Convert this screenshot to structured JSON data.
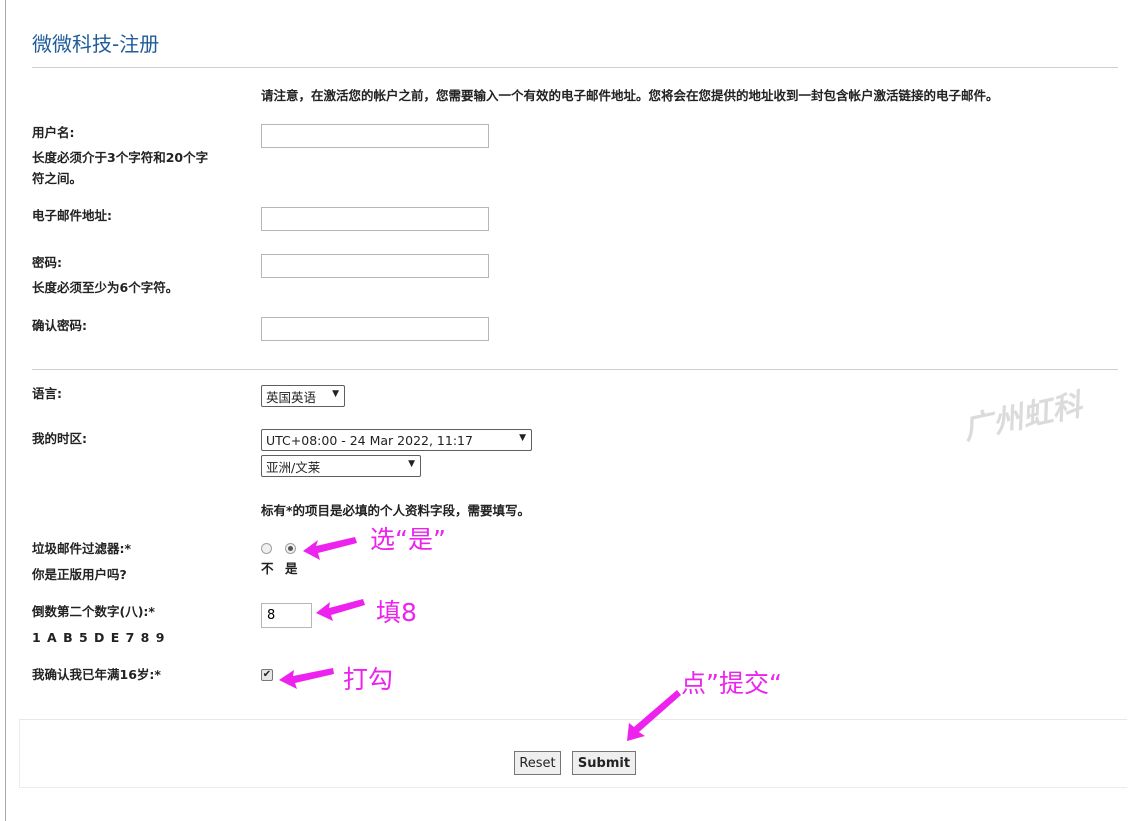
{
  "page": {
    "title": "微微科技-注册"
  },
  "notice": "请注意，在激活您的帐户之前，您需要输入一个有效的电子邮件地址。您将会在您提供的地址收到一封包含帐户激活链接的电子邮件。",
  "form": {
    "username": {
      "label": "用户名:",
      "hint_line1": "长度必须介于3个字符和20个字",
      "hint_line2": "符之间。",
      "value": ""
    },
    "email": {
      "label": "电子邮件地址:",
      "value": ""
    },
    "password": {
      "label": "密码:",
      "hint": "长度必须至少为6个字符。",
      "value": ""
    },
    "confirm": {
      "label": "确认密码:",
      "value": ""
    },
    "language": {
      "label": "语言:",
      "selected": "英国英语"
    },
    "timezone": {
      "label": "我的时区:",
      "selected_time": "UTC+08:00 - 24 Mar 2022, 11:17",
      "selected_region": "亚洲/文莱"
    },
    "required_note": "标有*的项目是必填的个人资料字段，需要填写。",
    "spam": {
      "label": "垃圾邮件过滤器:*",
      "question": "你是正版用户吗?",
      "option_no": "不",
      "option_yes": "是",
      "selected": "是"
    },
    "digit": {
      "label": "倒数第二个数字(八):*",
      "sequence": "1 A B 5 D E 7 8 9",
      "value": "8"
    },
    "age": {
      "label": "我确认我已年满16岁:*",
      "checked": true,
      "check_glyph": "✔"
    },
    "buttons": {
      "reset": "Reset",
      "submit": "Submit"
    }
  },
  "annotations": {
    "spam": "选“是”",
    "digit": "填8",
    "age": "打勾",
    "submit": "点”提交“",
    "color": "#ee22ee"
  },
  "watermark": "广州虹科"
}
